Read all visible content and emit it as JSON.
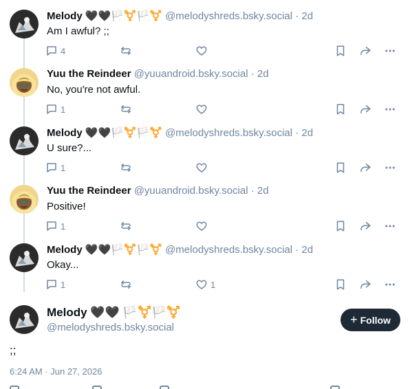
{
  "posts": [
    {
      "name": "Melody 🖤🖤🏳️⚧️🏳️⚧️",
      "name_text": "Melody",
      "handle": "@melodyshreds.bsky.social",
      "age": "2d",
      "text": "Am I awful? ;;",
      "replies": "4",
      "likes": "",
      "avatar": "melody"
    },
    {
      "name": "Yuu the Reindeer",
      "name_text": "Yuu the Reindeer",
      "handle": "@yuuandroid.bsky.social",
      "age": "2d",
      "text": "No, you're not awful.",
      "replies": "1",
      "likes": "",
      "avatar": "yuu"
    },
    {
      "name": "Melody 🖤🖤🏳️⚧️🏳️⚧️",
      "name_text": "Melody",
      "handle": "@melodyshreds.bsky.social",
      "age": "2d",
      "text": "U sure?...",
      "replies": "1",
      "likes": "",
      "avatar": "melody"
    },
    {
      "name": "Yuu the Reindeer",
      "name_text": "Yuu the Reindeer",
      "handle": "@yuuandroid.bsky.social",
      "age": "2d",
      "text": "Positive!",
      "replies": "1",
      "likes": "",
      "avatar": "yuu"
    },
    {
      "name": "Melody 🖤🖤🏳️⚧️🏳️⚧️",
      "name_text": "Melody",
      "handle": "@melodyshreds.bsky.social",
      "age": "2d",
      "text": "Okay...",
      "replies": "1",
      "likes": "1",
      "avatar": "melody"
    }
  ],
  "main_post": {
    "name": "Melody",
    "handle": "@melodyshreds.bsky.social",
    "follow_label": "Follow",
    "text": ";;",
    "timestamp": "6:24 AM · Jun 27, 2026"
  },
  "colors": {
    "muted": "#6f869f",
    "button_bg": "#1f2a37",
    "thread_line": "#d4dbe2"
  }
}
